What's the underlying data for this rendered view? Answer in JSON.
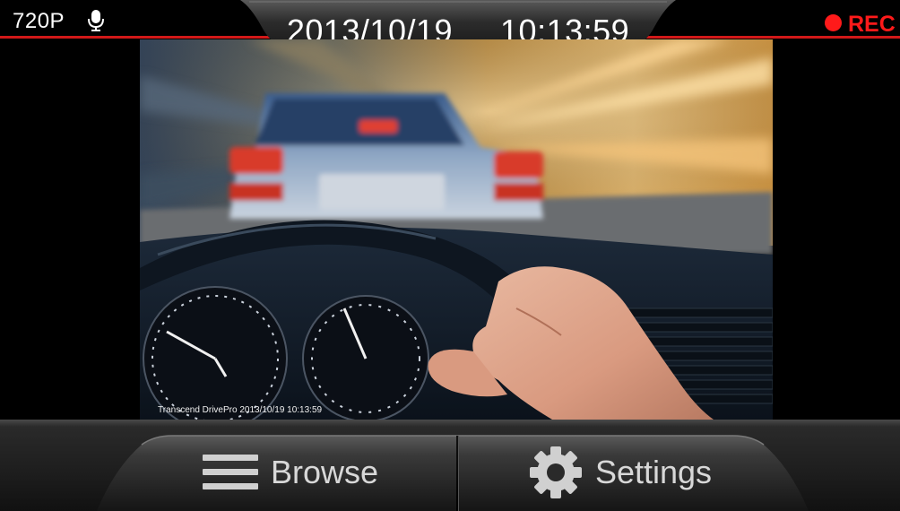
{
  "status_bar": {
    "resolution": "720P",
    "mic_icon": "microphone-icon",
    "datetime": "2013/10/19  10:13:59",
    "rec_label": "REC",
    "rec_color": "#ff1a1a",
    "line_color": "#d11818"
  },
  "video": {
    "watermark": "Transcend DrivePro 2013/10/19 10:13:59"
  },
  "toolbar": {
    "browse_label": "Browse",
    "browse_icon": "menu-icon",
    "settings_label": "Settings",
    "settings_icon": "gear-icon"
  }
}
